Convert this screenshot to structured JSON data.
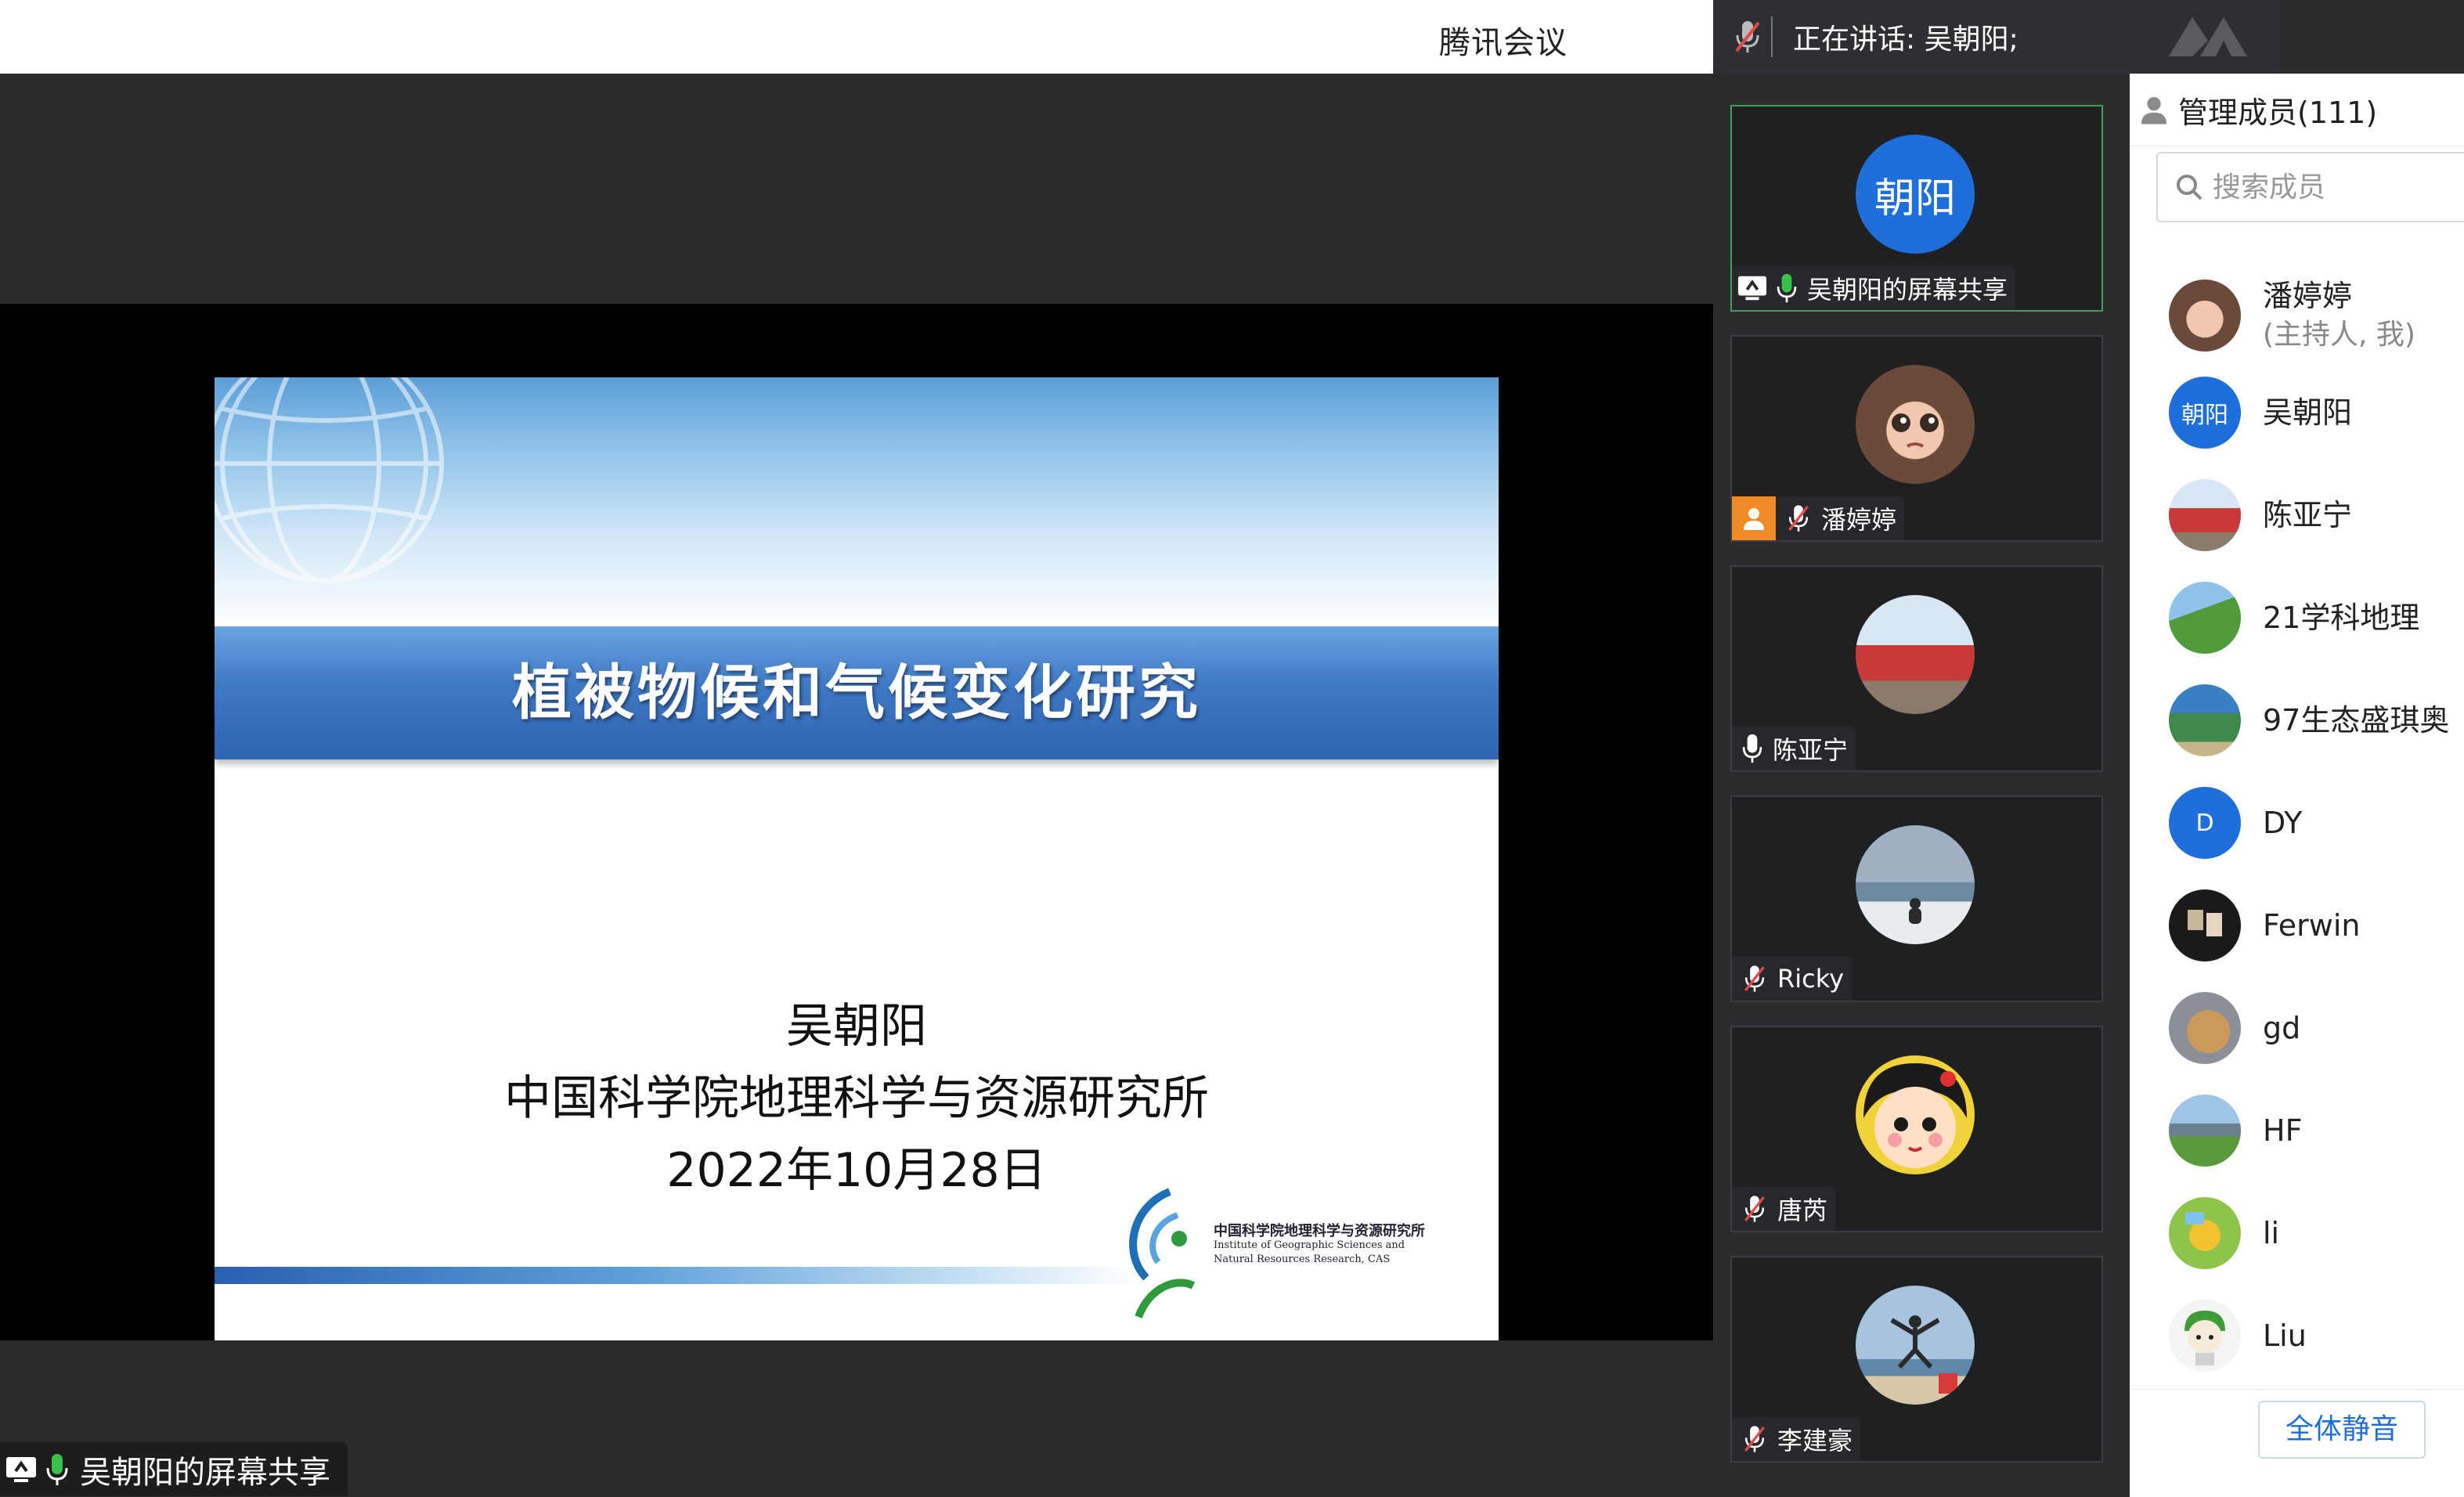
{
  "app": {
    "title": "腾讯会议"
  },
  "speaking": {
    "text": "正在讲话: 吴朝阳;"
  },
  "slide": {
    "title": "植被物候和气候变化研究",
    "author": "吴朝阳",
    "institute": "中国科学院地理科学与资源研究所",
    "date": "2022年10月28日",
    "logo_cn": "中国科学院地理科学与资源研究所",
    "logo_en_1": "Institute of Geographic Sciences and",
    "logo_en_2": "Natural Resources Research, CAS"
  },
  "share_label": "吴朝阳的屏幕共享",
  "tiles": [
    {
      "name": "吴朝阳的屏幕共享",
      "avatar_text": "朝阳",
      "active": true
    },
    {
      "name": "潘婷婷"
    },
    {
      "name": "陈亚宁"
    },
    {
      "name": "Ricky"
    },
    {
      "name": "唐芮"
    },
    {
      "name": "李建豪"
    }
  ],
  "members": {
    "header": "管理成员(111)",
    "search_placeholder": "搜索成员",
    "list": [
      {
        "name": "潘婷婷",
        "role": "(主持人, 我)"
      },
      {
        "name": "吴朝阳",
        "avatar_text": "朝阳"
      },
      {
        "name": "陈亚宁"
      },
      {
        "name": "21学科地理"
      },
      {
        "name": "97生态盛琪奥"
      },
      {
        "name": "DY",
        "avatar_text": "D"
      },
      {
        "name": "Ferwin"
      },
      {
        "name": "gd"
      },
      {
        "name": "HF"
      },
      {
        "name": "li"
      },
      {
        "name": "Liu"
      }
    ],
    "mute_all": "全体静音"
  },
  "colors": {
    "accent": "#1e6fd9",
    "active_border": "#3fa05a",
    "mic_green": "#39c24a"
  }
}
